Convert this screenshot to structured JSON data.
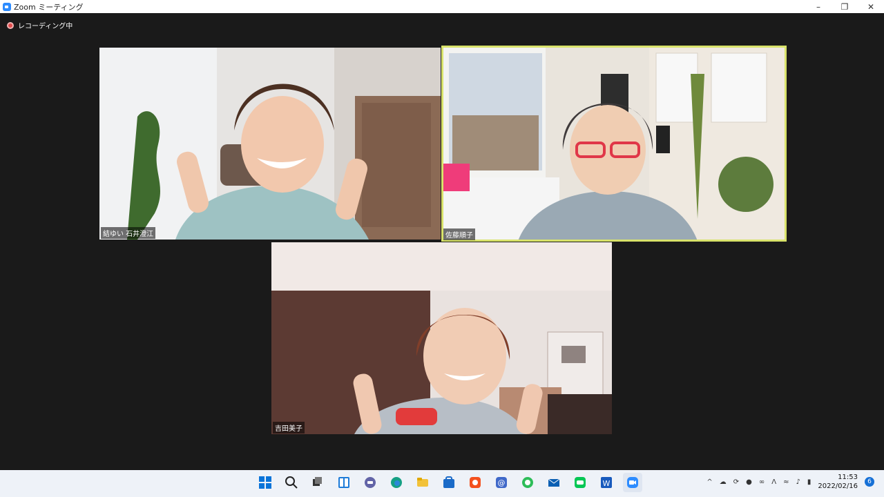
{
  "window": {
    "title": "Zoom ミーティング",
    "controls": [
      "minimize",
      "restore",
      "close"
    ]
  },
  "recording": {
    "label": "レコーディング中"
  },
  "participants": [
    {
      "name": "結ゆい 石井澄江",
      "active_speaker": false
    },
    {
      "name": "佐藤順子",
      "active_speaker": true
    },
    {
      "name": "吉田美子",
      "active_speaker": false
    }
  ],
  "taskbar": {
    "apps": [
      "windows-start-icon",
      "search-icon",
      "task-view-icon",
      "widgets-icon",
      "teams-chat-icon",
      "edge-icon",
      "file-explorer-icon",
      "microsoft-store-icon",
      "app-orange-icon",
      "mail-at-icon",
      "line-icon",
      "mail-icon",
      "line-green-icon",
      "word-icon",
      "zoom-icon"
    ],
    "clock": {
      "time": "11:53",
      "date": "2022/02/16"
    },
    "notifications": "6"
  },
  "colors": {
    "active_outline": "#d8e26a",
    "background": "#1a1a1a",
    "recording_dot": "#e04b4b"
  }
}
